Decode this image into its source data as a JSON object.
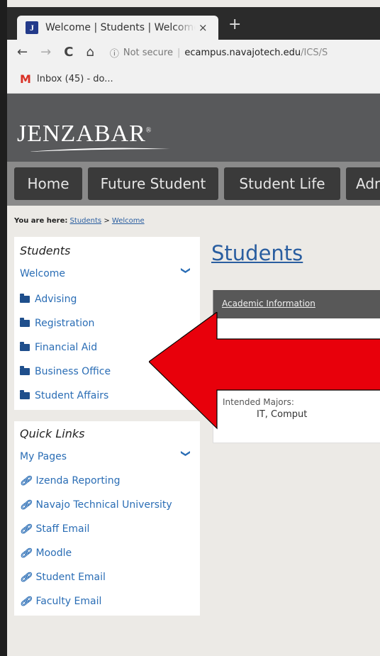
{
  "browser": {
    "tab_title": "Welcome | Students | Welcome",
    "favicon_letter": "J",
    "close_glyph": "×",
    "new_tab_glyph": "+",
    "nav": {
      "back": "←",
      "forward": "→",
      "reload": "C",
      "home": "⌂"
    },
    "security_label": "Not secure",
    "url_host": "ecampus.navajotech.edu",
    "url_path": "/ICS/S",
    "bookmark_label": "Inbox (45) - do..."
  },
  "site": {
    "logo_text": "JENZABAR",
    "logo_mark": "®",
    "nav_items": [
      "Home",
      "Future Student",
      "Student Life",
      "Adr"
    ]
  },
  "breadcrumb": {
    "prefix": "You are here:",
    "items": [
      "Students",
      "Welcome"
    ],
    "separator": ">"
  },
  "sidebar": {
    "section1": {
      "heading": "Students",
      "current": "Welcome",
      "items": [
        "Advising",
        "Registration",
        "Financial Aid",
        "Business Office",
        "Student Affairs"
      ]
    },
    "section2": {
      "heading": "Quick Links",
      "current": "My Pages",
      "items": [
        "Izenda Reporting",
        "Navajo Technical University",
        "Staff Email",
        "Moodle",
        "Student Email",
        "Faculty Email"
      ]
    },
    "chevron_glyph": "⌄"
  },
  "main": {
    "title": "Students",
    "panel_title": "Academic Information",
    "majors_label": "Intended Majors:",
    "majors_value": "IT, Comput"
  },
  "annotation": {
    "arrow_color": "#e8000b"
  }
}
